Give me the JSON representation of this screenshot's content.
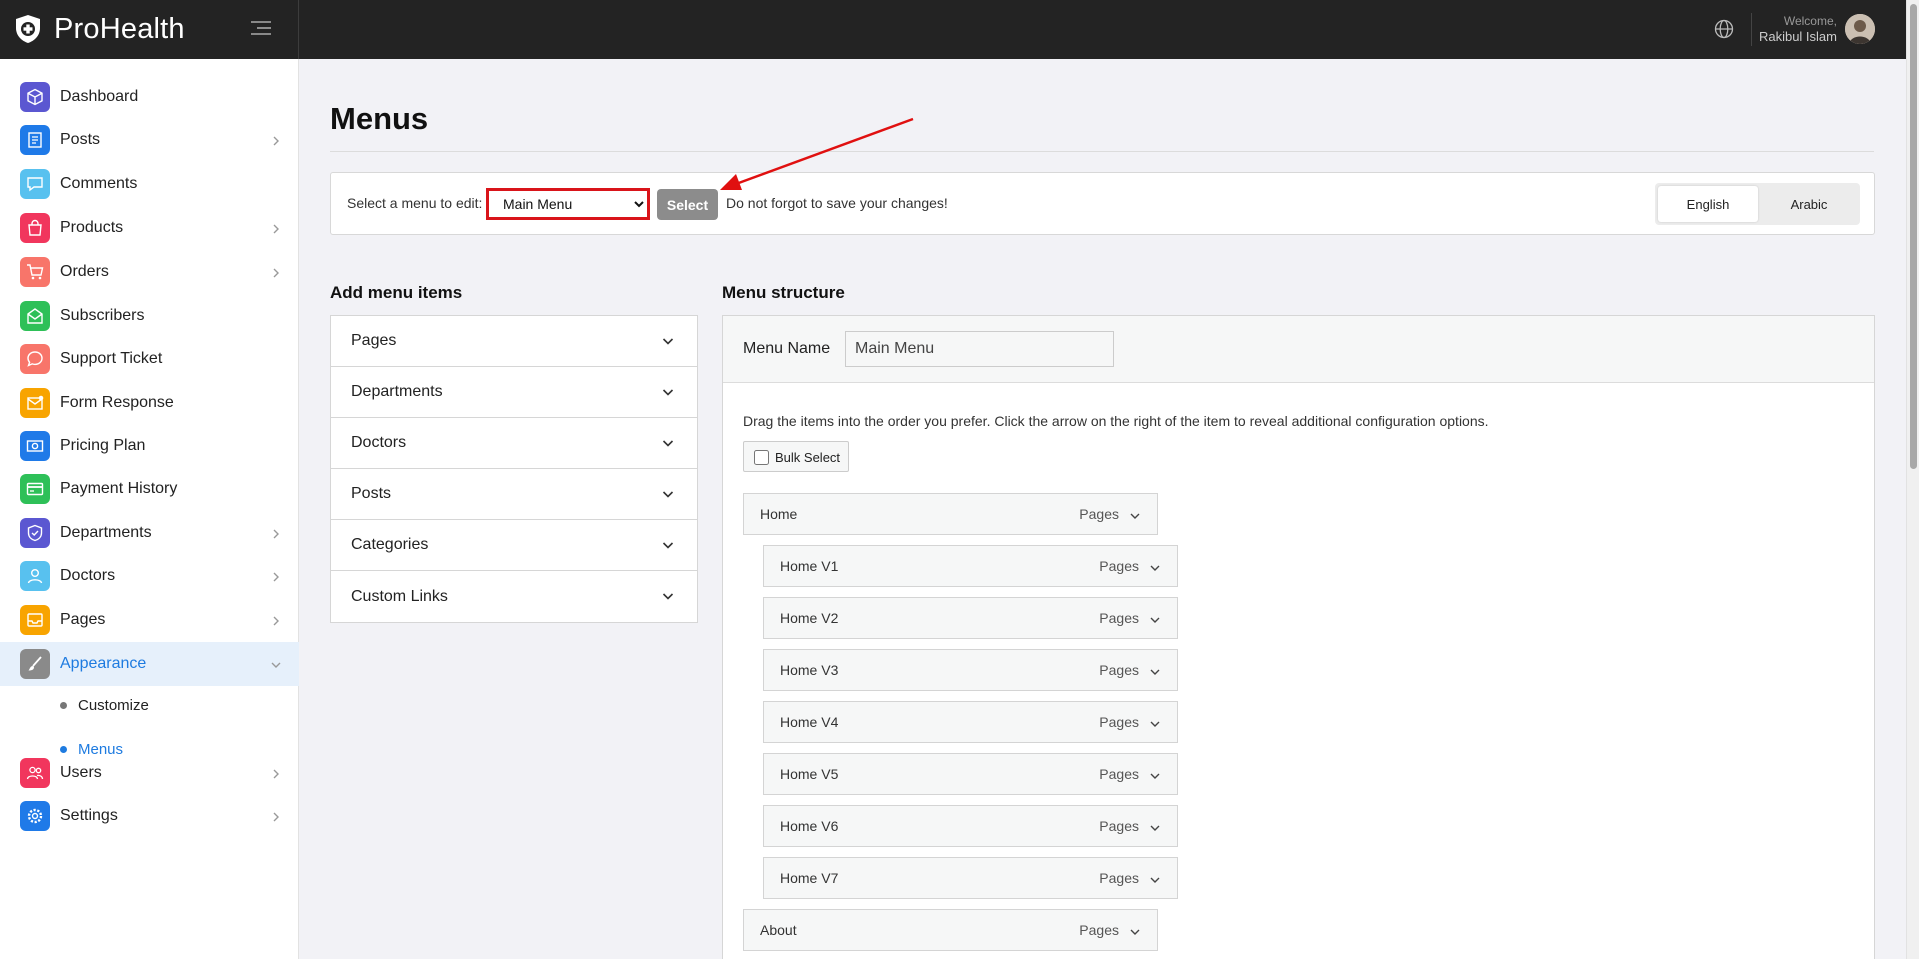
{
  "app": {
    "name": "ProHealth"
  },
  "header": {
    "welcome": "Welcome,",
    "user_name": "Rakibul Islam"
  },
  "sidebar": {
    "items": [
      {
        "label": "Dashboard",
        "icon": "cube-icon",
        "color": "#5b57d1",
        "chevron": false
      },
      {
        "label": "Posts",
        "icon": "document-icon",
        "color": "#1f7ae8",
        "chevron": true
      },
      {
        "label": "Comments",
        "icon": "chat-icon",
        "color": "#58c1ef",
        "chevron": false
      },
      {
        "label": "Products",
        "icon": "shopping-bag-icon",
        "color": "#f1365d",
        "chevron": true
      },
      {
        "label": "Orders",
        "icon": "cart-icon",
        "color": "#f8756a",
        "chevron": true
      },
      {
        "label": "Subscribers",
        "icon": "envelope-open-icon",
        "color": "#2ec058",
        "chevron": false
      },
      {
        "label": "Support Ticket",
        "icon": "speech-bubble-icon",
        "color": "#f8756a",
        "chevron": false
      },
      {
        "label": "Form Response",
        "icon": "mail-icon",
        "color": "#f8a400",
        "chevron": false
      },
      {
        "label": "Pricing Plan",
        "icon": "money-icon",
        "color": "#1f7ae8",
        "chevron": false
      },
      {
        "label": "Payment History",
        "icon": "credit-card-icon",
        "color": "#2ec058",
        "chevron": false
      },
      {
        "label": "Departments",
        "icon": "shield-icon",
        "color": "#5b57d1",
        "chevron": true
      },
      {
        "label": "Doctors",
        "icon": "user-icon",
        "color": "#58c1ef",
        "chevron": true
      },
      {
        "label": "Pages",
        "icon": "inbox-icon",
        "color": "#f8a400",
        "chevron": true
      },
      {
        "label": "Appearance",
        "icon": "brush-icon",
        "color": "#8a8a8a",
        "chevron": true,
        "expanded": true
      },
      {
        "label": "Users",
        "icon": "users-icon",
        "color": "#f1365d",
        "chevron": true
      },
      {
        "label": "Settings",
        "icon": "gear-icon",
        "color": "#1f7ae8",
        "chevron": true
      }
    ],
    "appearance_sub": [
      {
        "label": "Customize"
      },
      {
        "label": "Menus"
      }
    ]
  },
  "page": {
    "title": "Menus"
  },
  "select_bar": {
    "label": "Select a menu to edit:",
    "selected_menu": "Main Menu",
    "button": "Select",
    "hint": "Do not forgot to save your changes!",
    "languages": [
      "English",
      "Arabic"
    ],
    "active_language": "English",
    "highlight_color": "#d9141a"
  },
  "add_items": {
    "heading": "Add menu items",
    "sections": [
      "Pages",
      "Departments",
      "Doctors",
      "Posts",
      "Categories",
      "Custom Links"
    ]
  },
  "structure": {
    "heading": "Menu structure",
    "name_label": "Menu Name",
    "name_value": "Main Menu",
    "hint": "Drag the items into the order you prefer. Click the arrow on the right of the item to reveal additional configuration options.",
    "bulk_select": "Bulk Select",
    "items": [
      {
        "name": "Home",
        "type": "Pages",
        "level": 0
      },
      {
        "name": "Home V1",
        "type": "Pages",
        "level": 1
      },
      {
        "name": "Home V2",
        "type": "Pages",
        "level": 1
      },
      {
        "name": "Home V3",
        "type": "Pages",
        "level": 1
      },
      {
        "name": "Home V4",
        "type": "Pages",
        "level": 1
      },
      {
        "name": "Home V5",
        "type": "Pages",
        "level": 1
      },
      {
        "name": "Home V6",
        "type": "Pages",
        "level": 1
      },
      {
        "name": "Home V7",
        "type": "Pages",
        "level": 1
      },
      {
        "name": "About",
        "type": "Pages",
        "level": 0
      }
    ]
  }
}
